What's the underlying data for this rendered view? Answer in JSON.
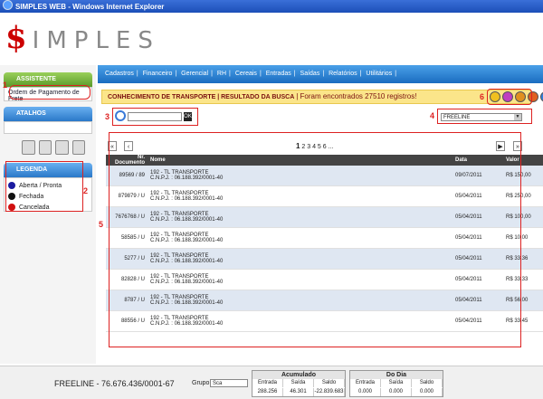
{
  "window": {
    "title": "SIMPLES WEB - Windows Internet Explorer"
  },
  "logo": {
    "dollar": "$",
    "rest": "IMPLES"
  },
  "sidebar": {
    "assistente": {
      "title": "ASSISTENTE",
      "link": "Ordem de Pagamento de Frete"
    },
    "atalhos": {
      "title": "ATALHOS"
    },
    "legenda": {
      "title": "LEGENDA",
      "items": [
        {
          "label": "Aberta / Pronta",
          "color": "#1a1aa0"
        },
        {
          "label": "Fechada",
          "color": "#111111"
        },
        {
          "label": "Cancelada",
          "color": "#d01010"
        }
      ]
    }
  },
  "menu": {
    "items": [
      "Cadastros",
      "|",
      "Financeiro",
      "|",
      "Gerencial",
      "|",
      "RH",
      "|",
      "Cereais",
      "|",
      "Entradas",
      "|",
      "Saídas",
      "|",
      "Relatórios",
      "|",
      "Utilitários",
      "|"
    ]
  },
  "info": {
    "path": "CONHECIMENTO DE TRANSPORTE | RESULTADO DA BUSCA",
    "count": "| Foram encontrados 27510 registros!"
  },
  "search": {
    "placeholder": "",
    "ok": "OK"
  },
  "filter": {
    "selected": "FREELINE"
  },
  "pager": {
    "current": "1",
    "others": "2 3 4 5 6 ..."
  },
  "table": {
    "headers": [
      "Nr. Documento",
      "Nome",
      "Data",
      "Valor"
    ],
    "rows": [
      {
        "doc": "89569 / 89",
        "nome": "192 - TL TRANSPORTE",
        "cnpj": "C.N.P.J. : 06.188.392/0001-40",
        "data": "09/07/2011",
        "valor": "R$ 150,00"
      },
      {
        "doc": "879879 / U",
        "nome": "192 - TL TRANSPORTE",
        "cnpj": "C.N.P.J. : 06.188.392/0001-40",
        "data": "05/04/2011",
        "valor": "R$ 250,00"
      },
      {
        "doc": "7676768 / U",
        "nome": "192 - TL TRANSPORTE",
        "cnpj": "C.N.P.J. : 06.188.392/0001-40",
        "data": "05/04/2011",
        "valor": "R$ 100,00"
      },
      {
        "doc": "58585 / U",
        "nome": "192 - TL TRANSPORTE",
        "cnpj": "C.N.P.J. : 06.188.392/0001-40",
        "data": "05/04/2011",
        "valor": "R$ 10,00"
      },
      {
        "doc": "5277 / U",
        "nome": "192 - TL TRANSPORTE",
        "cnpj": "C.N.P.J. : 06.188.392/0001-40",
        "data": "05/04/2011",
        "valor": "R$ 33,36"
      },
      {
        "doc": "82828 / U",
        "nome": "192 - TL TRANSPORTE",
        "cnpj": "C.N.P.J. : 06.188.392/0001-40",
        "data": "05/04/2011",
        "valor": "R$ 33,33"
      },
      {
        "doc": "8787 / U",
        "nome": "192 - TL TRANSPORTE",
        "cnpj": "C.N.P.J. : 06.188.392/0001-40",
        "data": "05/04/2011",
        "valor": "R$ 56,00"
      },
      {
        "doc": "88556 / U",
        "nome": "192 - TL TRANSPORTE",
        "cnpj": "C.N.P.J. : 06.188.392/0001-40",
        "data": "05/04/2011",
        "valor": "R$ 33,45"
      }
    ]
  },
  "footer": {
    "company": "FREELINE - 76.676.436/0001-67",
    "grupo_label": "Grupo:",
    "grupo_value": "Sca",
    "acumulado": {
      "title": "Acumulado",
      "cols": [
        "Entrada",
        "Saída",
        "Saldo"
      ],
      "vals": [
        "288.256",
        "46.301",
        "-22.839.683"
      ]
    },
    "dodia": {
      "title": "Do Dia",
      "cols": [
        "Entrada",
        "Saída",
        "Saldo"
      ],
      "vals": [
        "0.000",
        "0.000",
        "0.000"
      ]
    }
  },
  "annotations": [
    "1",
    "2",
    "3",
    "4",
    "5",
    "6"
  ]
}
